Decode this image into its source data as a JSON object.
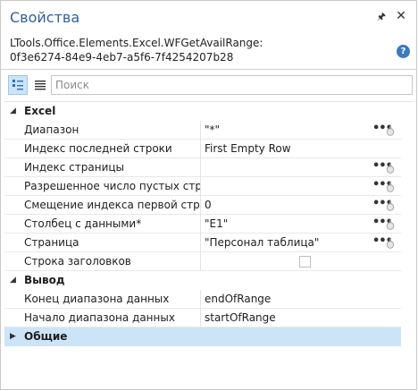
{
  "panel": {
    "title": "Свойства",
    "pin_glyph": "🖈",
    "close_glyph": "✕",
    "subtitle_line1": "LTools.Office.Elements.Excel.WFGetAvailRange:",
    "subtitle_line2": "0f3e6274-84e9-4eb7-a5f6-7f4254207b28",
    "help_glyph": "?"
  },
  "toolbar": {
    "search_placeholder": "Поиск"
  },
  "categories": {
    "excel": "Excel",
    "output": "Вывод",
    "general": "Общие"
  },
  "properties": {
    "range": {
      "name": "Диапазон",
      "value": "\"*\""
    },
    "last_row_index": {
      "name": "Индекс последней строки",
      "value": "First Empty Row"
    },
    "page_index": {
      "name": "Индекс страницы",
      "value": ""
    },
    "allowed_empty_rows": {
      "name": "Разрешенное число пустых строк",
      "value": ""
    },
    "first_row_offset": {
      "name": "Смещение индекса первой строки",
      "value": "0"
    },
    "data_column": {
      "name": "Столбец с данными*",
      "value": "\"E1\""
    },
    "sheet": {
      "name": "Страница",
      "value": "\"Персонал таблица\""
    },
    "header_row": {
      "name": "Строка заголовков",
      "checked": false
    },
    "range_end": {
      "name": "Конец диапазона данных",
      "value": "endOfRange"
    },
    "range_start": {
      "name": "Начало диапазона данных",
      "value": "startOfRange"
    }
  },
  "icons": {
    "ellipsis": "•••",
    "expand_arrow": "◢",
    "collapsed_arrow": "▶"
  }
}
